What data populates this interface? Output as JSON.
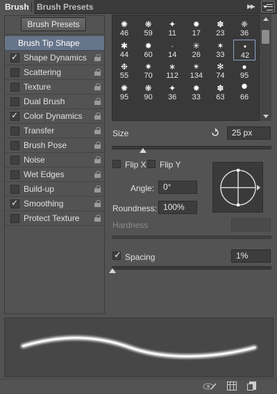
{
  "tabs": {
    "brush": "Brush",
    "brush_presets": "Brush Presets"
  },
  "left": {
    "presets_button": "Brush Presets",
    "options": [
      {
        "label": "Brush Tip Shape",
        "checked": null,
        "selected": true
      },
      {
        "label": "Shape Dynamics",
        "checked": true
      },
      {
        "label": "Scattering",
        "checked": false
      },
      {
        "label": "Texture",
        "checked": false
      },
      {
        "label": "Dual Brush",
        "checked": false
      },
      {
        "label": "Color Dynamics",
        "checked": true
      },
      {
        "label": "Transfer",
        "checked": false
      },
      {
        "label": "Brush Pose",
        "checked": false
      },
      {
        "label": "Noise",
        "checked": false
      },
      {
        "label": "Wet Edges",
        "checked": false
      },
      {
        "label": "Build-up",
        "checked": false
      },
      {
        "label": "Smoothing",
        "checked": true
      },
      {
        "label": "Protect Texture",
        "checked": false
      }
    ]
  },
  "tips": {
    "sizes": [
      [
        "46",
        "59",
        "11",
        "17",
        "23",
        "36"
      ],
      [
        "44",
        "60",
        "14",
        "26",
        "33",
        "42"
      ],
      [
        "55",
        "70",
        "112",
        "134",
        "74",
        "95"
      ],
      [
        "95",
        "90",
        "36",
        "33",
        "63",
        "66"
      ]
    ],
    "selected": "42"
  },
  "size": {
    "label": "Size",
    "value": "25 px",
    "slider_fraction": 0.1
  },
  "flip_x": {
    "label": "Flip X",
    "checked": false
  },
  "flip_y": {
    "label": "Flip Y",
    "checked": false
  },
  "angle": {
    "label": "Angle:",
    "value": "0°"
  },
  "roundness": {
    "label": "Roundness:",
    "value": "100%"
  },
  "hardness": {
    "label": "Hardness",
    "value": ""
  },
  "spacing": {
    "label": "Spacing",
    "checked": true,
    "value": "1%",
    "slider_fraction": 0.0
  },
  "colors": {
    "panel_bg": "#535353",
    "selection": "#67758a",
    "dark_field": "#393939"
  },
  "icons": [
    "collapse-icon",
    "panel-menu-icon",
    "lock-icon",
    "reset-icon",
    "toggle-preview-icon",
    "grid-icon",
    "new-preset-icon"
  ]
}
